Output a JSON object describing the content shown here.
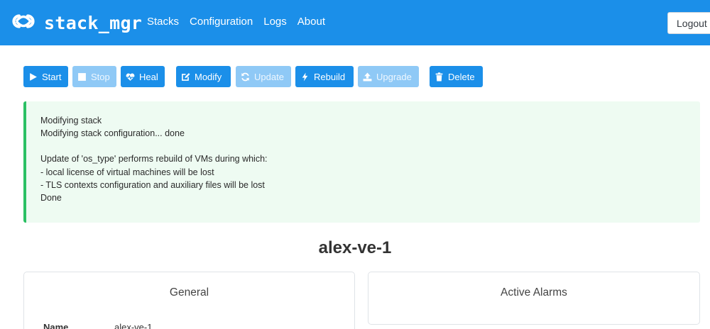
{
  "app": {
    "name": "stack_mgr"
  },
  "nav": {
    "links": [
      "Stacks",
      "Configuration",
      "Logs",
      "About"
    ],
    "logout_label": "Logout"
  },
  "toolbar": {
    "buttons": [
      {
        "label": "Start",
        "icon": "play-icon",
        "enabled": true
      },
      {
        "label": "Stop",
        "icon": "stop-icon",
        "enabled": false
      },
      {
        "label": "Heal",
        "icon": "heartbeat-icon",
        "enabled": true
      },
      {
        "label": "Modify",
        "icon": "edit-icon",
        "enabled": true
      },
      {
        "label": "Update",
        "icon": "sync-icon",
        "enabled": false
      },
      {
        "label": "Rebuild",
        "icon": "bolt-icon",
        "enabled": true
      },
      {
        "label": "Upgrade",
        "icon": "upload-icon",
        "enabled": false
      },
      {
        "label": "Delete",
        "icon": "trash-icon",
        "enabled": true
      }
    ]
  },
  "alert": {
    "lines": [
      "Modifying stack",
      "Modifying stack configuration... done",
      "",
      "Update of 'os_type' performs rebuild of VMs during which:",
      "- local license of virtual machines will be lost",
      "- TLS contexts configuration and auxiliary files will be lost",
      "Done"
    ]
  },
  "stack": {
    "title": "alex-ve-1"
  },
  "general": {
    "title": "General",
    "fields": [
      {
        "label": "Name",
        "value": "alex-ve-1"
      }
    ]
  },
  "alarms": {
    "title": "Active Alarms"
  },
  "colors": {
    "primary": "#1b8fe9",
    "disabled": "#8fc9f6",
    "success_border": "#2bc064",
    "success_bg": "#eefbf2"
  }
}
